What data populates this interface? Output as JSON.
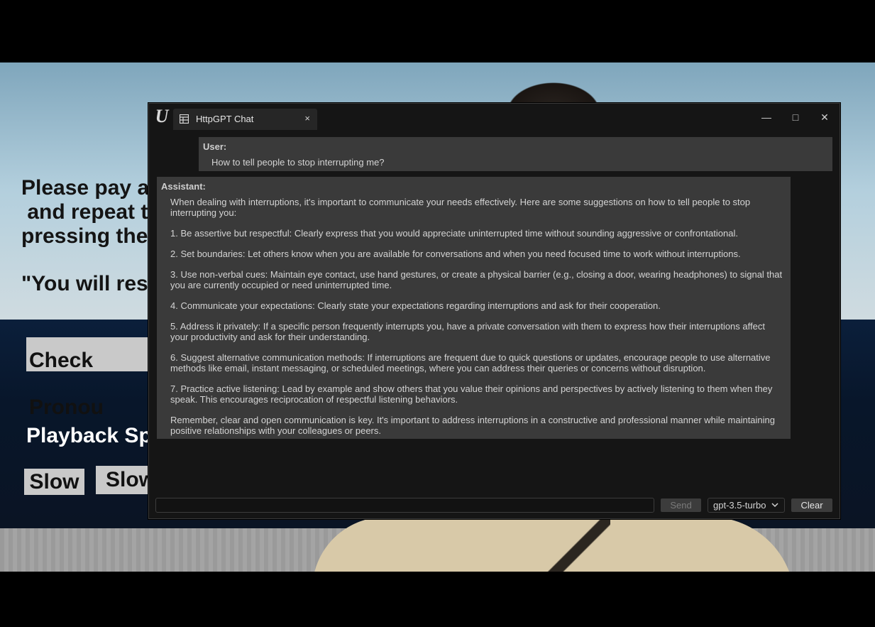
{
  "scene": {
    "instruction_text": "Please pay att\n and repeat the\npressing the b",
    "quote_text": "\"You will respe",
    "check_button": "Check Pronou",
    "playback_heading": "Playback Spe",
    "slow_button_1": "Slow",
    "slow_button_2": "Slow"
  },
  "window": {
    "tab_label": "HttpGPT Chat",
    "tab_close": "×",
    "minimize": "—",
    "maximize": "□",
    "close": "✕"
  },
  "chat": {
    "user": {
      "role": "User:",
      "text": "How to tell people to stop interrupting me?"
    },
    "assistant": {
      "role": "Assistant:",
      "paragraphs": [
        "When dealing with interruptions, it's important to communicate your needs effectively. Here are some suggestions on how to tell people to stop interrupting you:",
        "1. Be assertive but respectful: Clearly express that you would appreciate uninterrupted time without sounding aggressive or confrontational.",
        "2. Set boundaries: Let others know when you are available for conversations and when you need focused time to work without interruptions.",
        "3. Use non-verbal cues: Maintain eye contact, use hand gestures, or create a physical barrier (e.g., closing a door, wearing headphones) to signal that you are currently occupied or need uninterrupted time.",
        "4. Communicate your expectations: Clearly state your expectations regarding interruptions and ask for their cooperation.",
        "5. Address it privately: If a specific person frequently interrupts you, have a private conversation with them to express how their interruptions affect your productivity and ask for their understanding.",
        "6. Suggest alternative communication methods: If interruptions are frequent due to quick questions or updates, encourage people to use alternative methods like email, instant messaging, or scheduled meetings, where you can address their queries or concerns without disruption.",
        "7. Practice active listening: Lead by example and show others that you value their opinions and perspectives by actively listening to them when they speak. This encourages reciprocation of respectful listening behaviors.",
        "Remember, clear and open communication is key. It's important to address interruptions in a constructive and professional manner while maintaining positive relationships with your colleagues or peers."
      ]
    }
  },
  "input": {
    "value": "",
    "placeholder": "",
    "send_label": "Send",
    "model_selected": "gpt-3.5-turbo",
    "clear_label": "Clear"
  }
}
